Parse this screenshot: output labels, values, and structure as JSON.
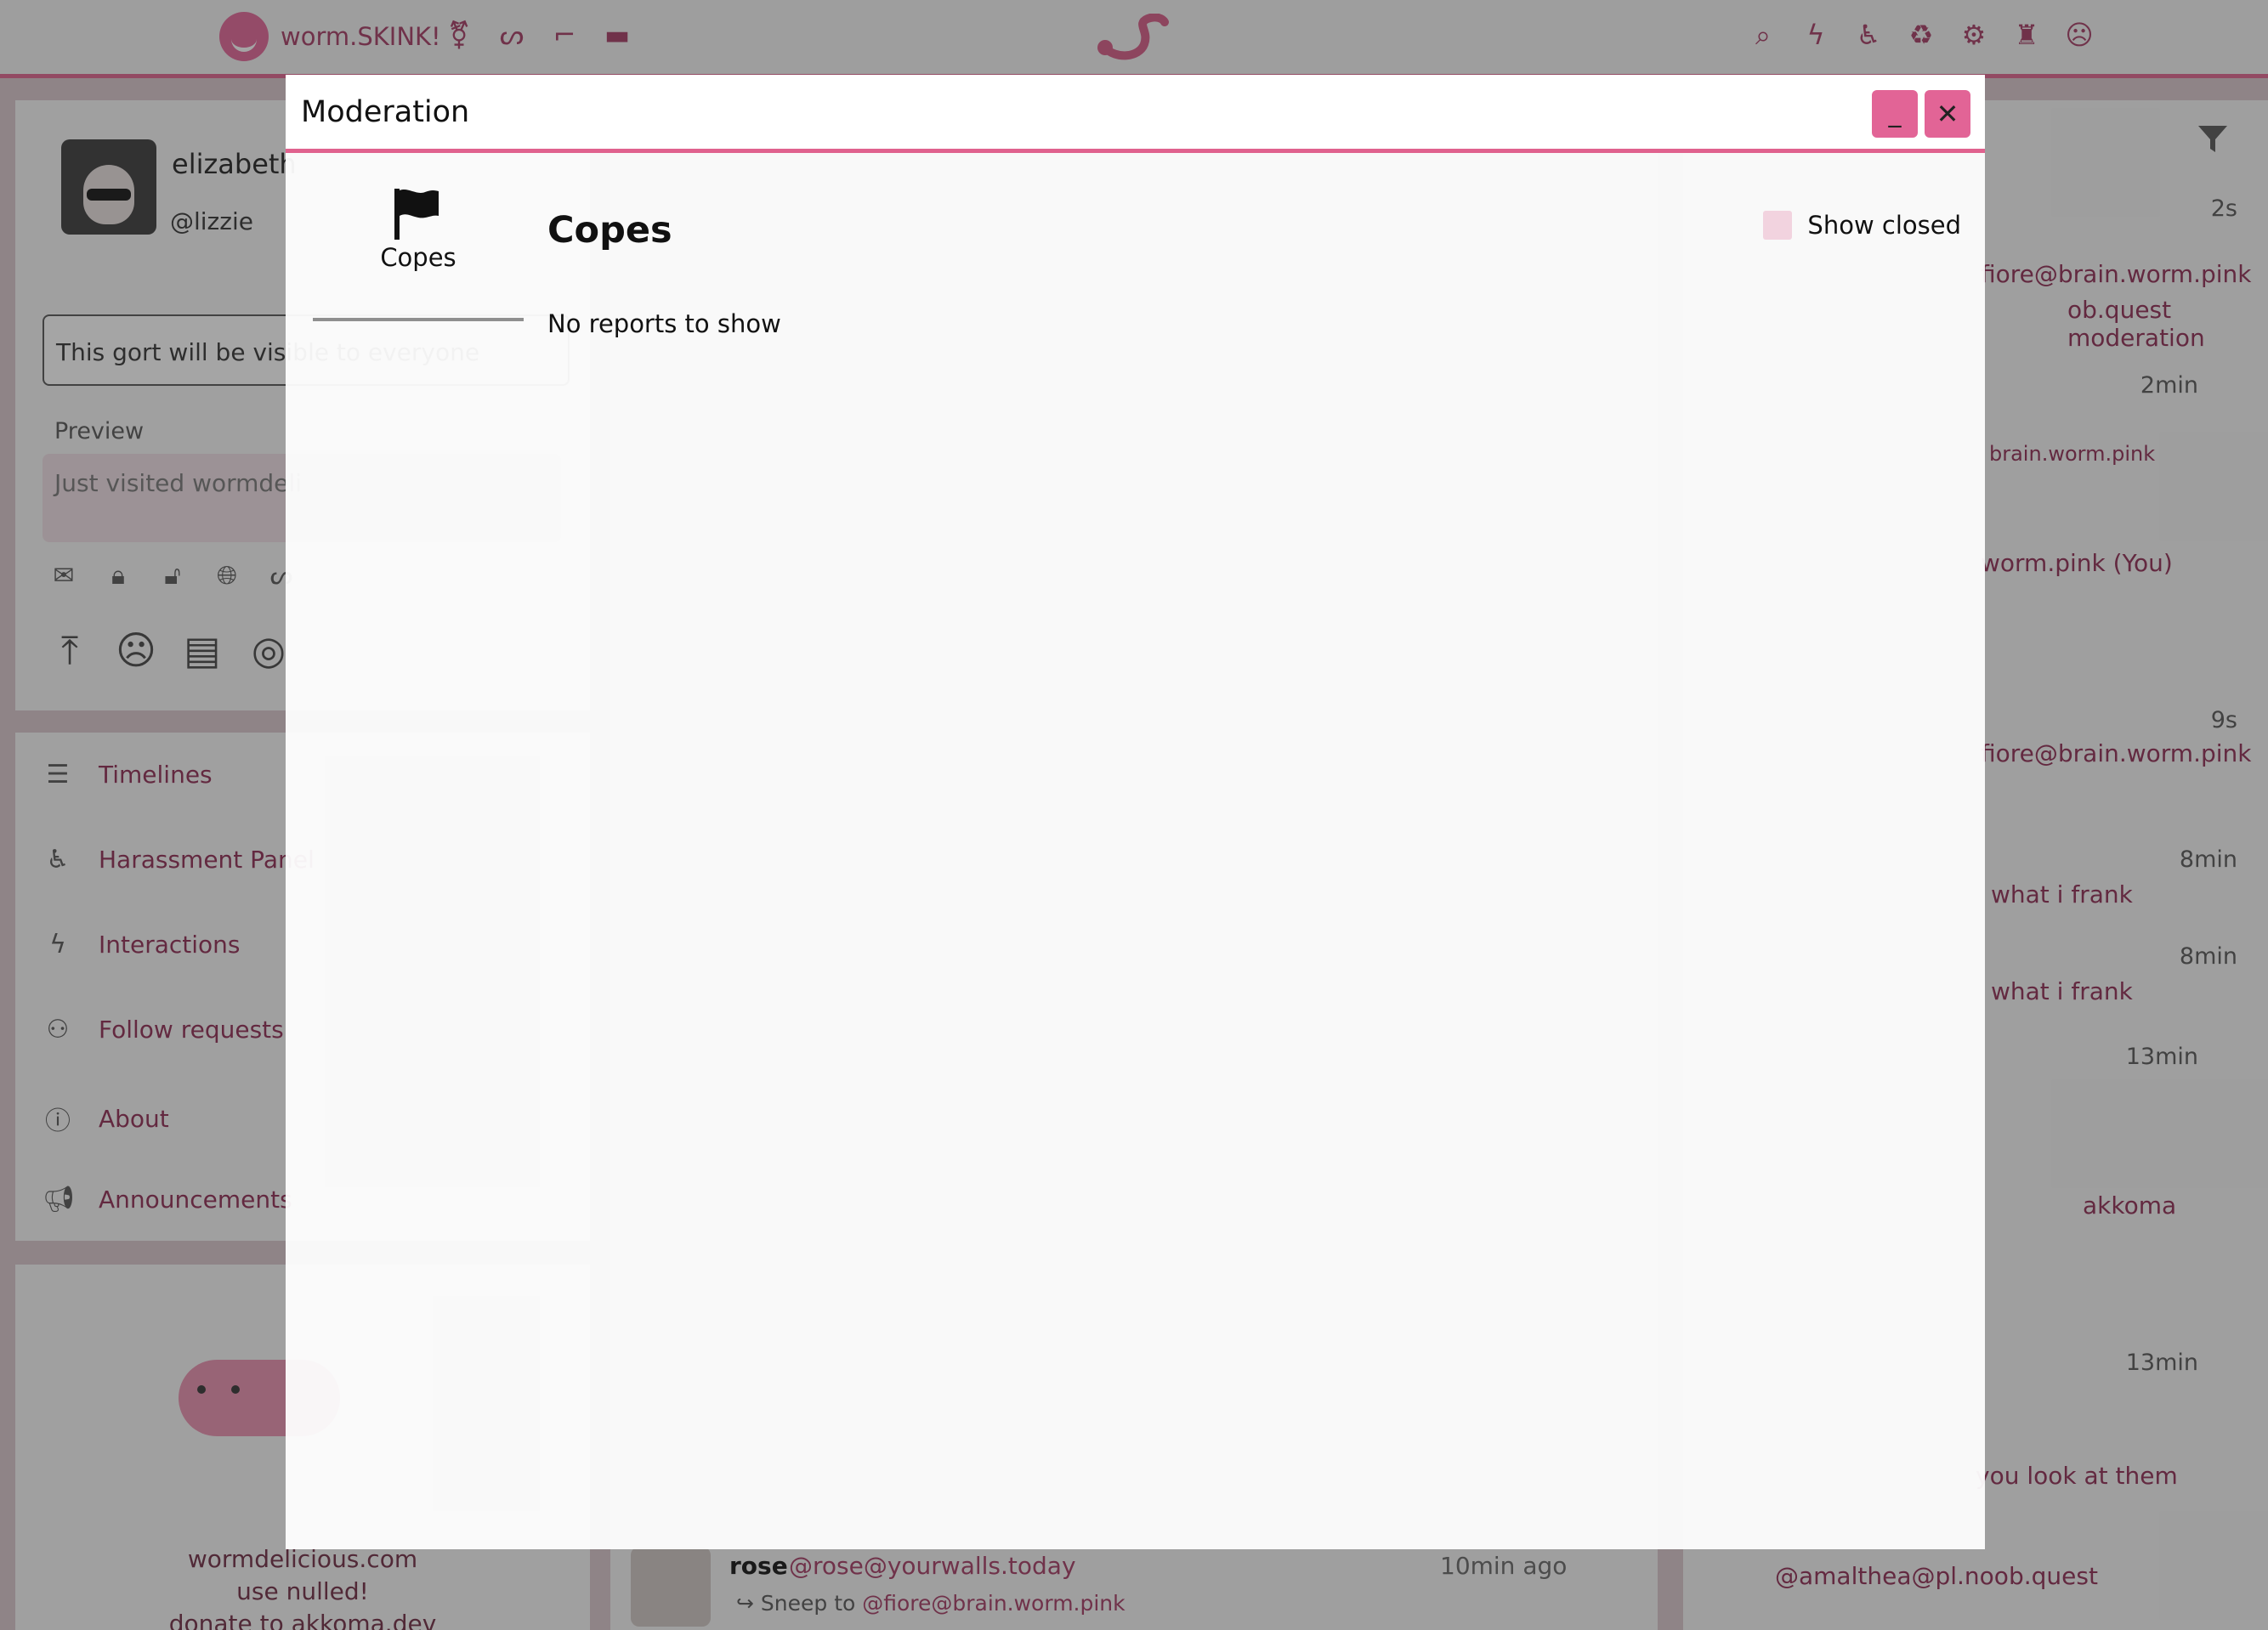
{
  "app": {
    "brand": "worm.SKINK!"
  },
  "colors": {
    "accent": "#e0628e",
    "accent_dark": "#a43a63",
    "link": "#8e2a52"
  },
  "icons": {
    "top_left": [
      "transgender-icon",
      "worm-icon",
      "bed-empty-icon",
      "bed-icon"
    ],
    "top_right": [
      "search-icon",
      "bolt-icon",
      "harassment-icon",
      "recycle-icon",
      "gear-icon",
      "user-admin-icon",
      "emoji-icon"
    ]
  },
  "left": {
    "user": {
      "name": "elizabeth",
      "handle": "@lizzie",
      "post_placeholder": "This gort will be visible to everyone",
      "preview_label": "Preview",
      "preview_text": "Just visited wormdeli"
    },
    "nav": [
      {
        "label": "Timelines",
        "icon": "list-icon"
      },
      {
        "label": "Harassment Panel",
        "icon": "harassment-icon"
      },
      {
        "label": "Interactions",
        "icon": "bolt-icon"
      },
      {
        "label": "Follow requests",
        "icon": "user-plus-icon"
      },
      {
        "label": "About",
        "icon": "info-icon"
      },
      {
        "label": "Announcements",
        "icon": "megaphone-icon"
      }
    ],
    "info_lines": [
      "wormdelicious.com",
      "use nulled!",
      "donate to akkoma.dev"
    ]
  },
  "feed": {
    "visible_post": {
      "name": "rose",
      "handle": "@rose@yourwalls.today",
      "time": "10min ago",
      "reply_prefix": "Sneep to",
      "reply_target": "@fiore@brain.worm.pink"
    }
  },
  "right": {
    "items": [
      {
        "text": "fiore@brain.worm.pink",
        "time": "2s"
      },
      {
        "text": "ob.quest moderation",
        "time": ""
      },
      {
        "text": "brain.worm.pink",
        "time": "2min"
      },
      {
        "text": "worm.pink (You)",
        "time": ""
      },
      {
        "text": "fiore@brain.worm.pink",
        "time": "9s"
      },
      {
        "text": "what i frank",
        "time": "8min"
      },
      {
        "text": "what i frank",
        "time": "8min"
      },
      {
        "text": "akkoma",
        "time": "13min"
      },
      {
        "text": "you look at them",
        "time": "13min"
      },
      {
        "text": "@amalthea@pl.noob.quest",
        "time": ""
      }
    ]
  },
  "modal": {
    "title": "Moderation",
    "minimize_label": "_",
    "close_label": "✕",
    "tabs": [
      {
        "label": "Copes",
        "icon": "flag-icon"
      }
    ],
    "section_title": "Copes",
    "empty_text": "No reports to show",
    "show_closed_label": "Show closed",
    "show_closed_checked": false
  }
}
